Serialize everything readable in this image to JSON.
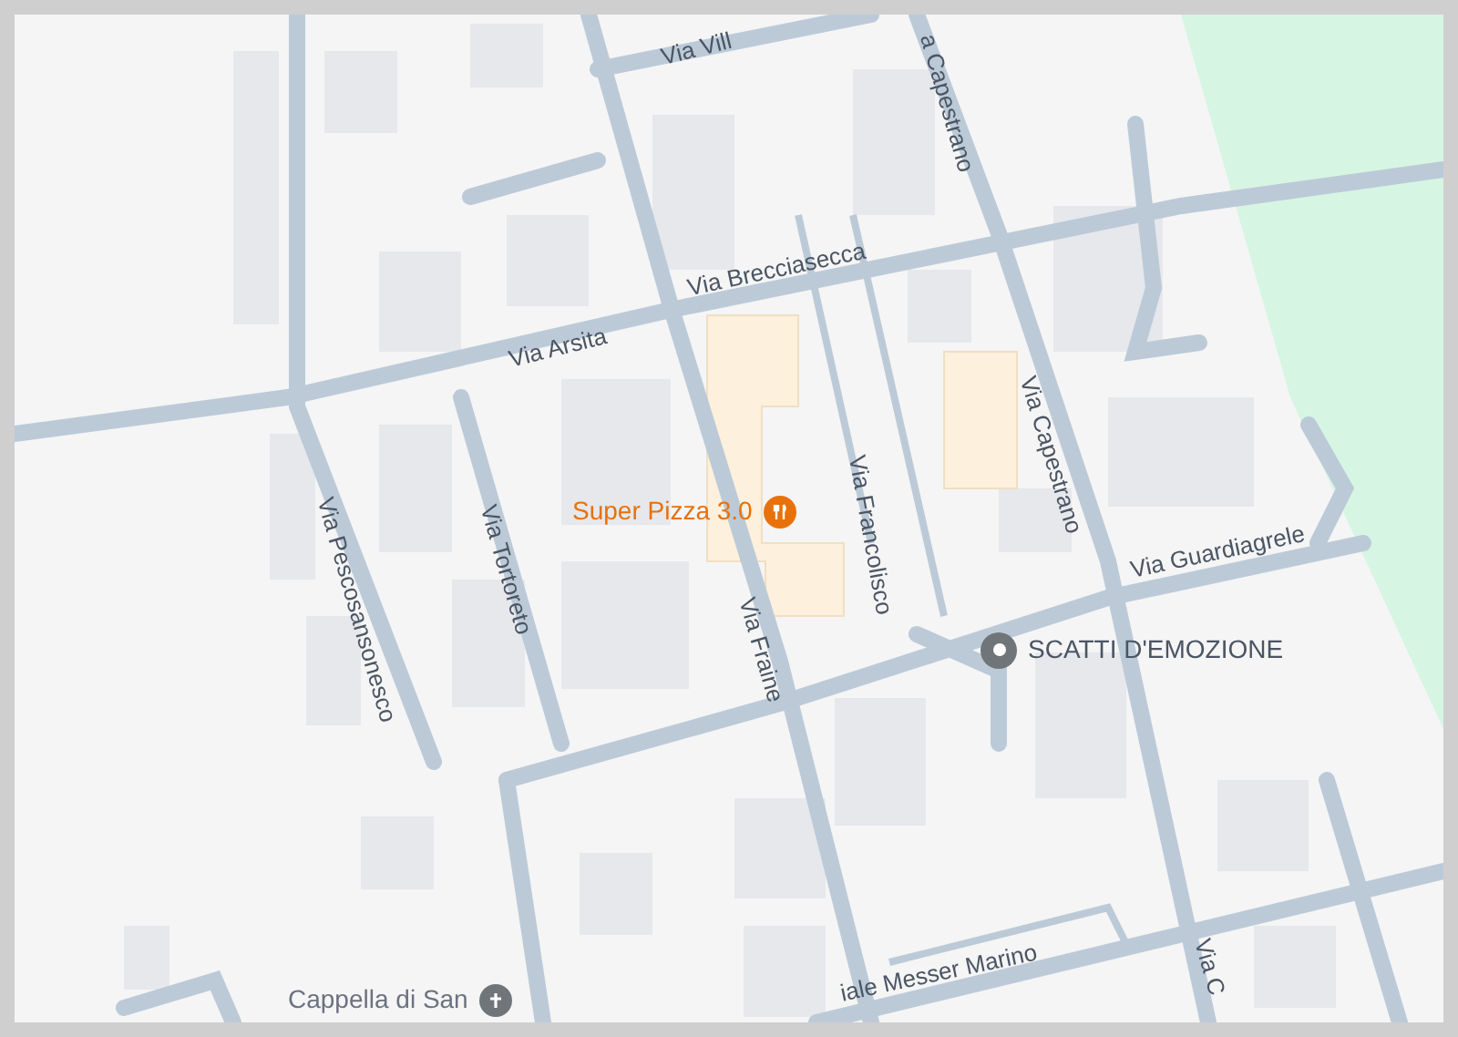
{
  "map": {
    "streets": [
      {
        "name": "Via Vill"
      },
      {
        "name": "a Capestrano"
      },
      {
        "name": "Via Brecciasecca"
      },
      {
        "name": "Via Arsita"
      },
      {
        "name": "Via Pescosansonesco"
      },
      {
        "name": "Via Tortoreto"
      },
      {
        "name": "Via Fraine"
      },
      {
        "name": "Via Francolisco"
      },
      {
        "name": "Via Capestrano"
      },
      {
        "name": "Via Guardiagrele"
      },
      {
        "name": "iale Messer Marino"
      },
      {
        "name": "Via C"
      }
    ],
    "places": [
      {
        "name": "Super Pizza 3.0",
        "kind": "restaurant"
      },
      {
        "name": "SCATTI D'EMOZIONE",
        "kind": "pin"
      },
      {
        "name": "Cappella di San",
        "kind": "church"
      }
    ]
  }
}
